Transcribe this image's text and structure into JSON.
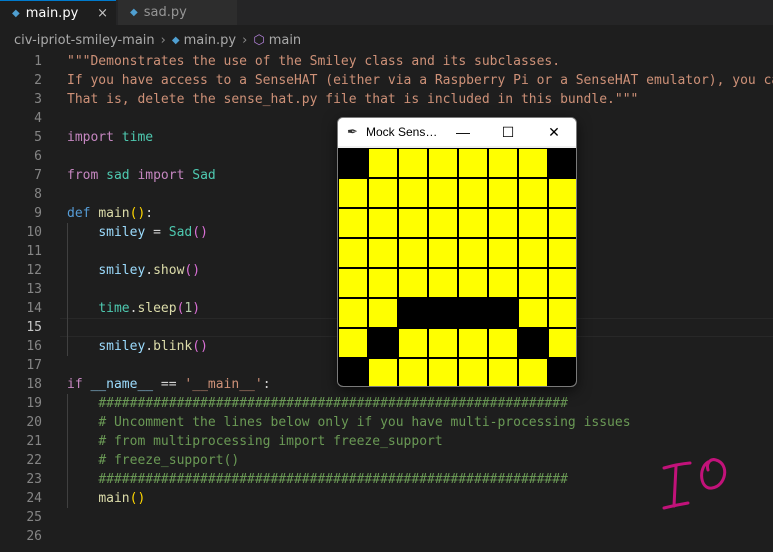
{
  "tabs": [
    {
      "label": "main.py",
      "close": "×"
    },
    {
      "label": "sad.py",
      "close": "×"
    }
  ],
  "breadcrumb": {
    "folder": "civ-ipriot-smiley-main",
    "file": "main.py",
    "symbol": "main"
  },
  "editor": {
    "current_line": 15,
    "lines": [
      {
        "no": "1",
        "tokens": [
          {
            "t": "\"\"\"Demonstrates the use of the Smiley class and its subclasses.",
            "c": "s"
          }
        ]
      },
      {
        "no": "2",
        "tokens": [
          {
            "t": "If you have access to a SenseHAT (either via a Raspberry Pi or a SenseHAT emulator), you can",
            "c": "s"
          }
        ]
      },
      {
        "no": "3",
        "tokens": [
          {
            "t": "That is, delete the sense_hat.py file that is included in this bundle.\"\"\"",
            "c": "s"
          }
        ]
      },
      {
        "no": "4",
        "tokens": []
      },
      {
        "no": "5",
        "tokens": [
          {
            "t": "import",
            "c": "k"
          },
          {
            "t": " ",
            "c": "p"
          },
          {
            "t": "time",
            "c": "m"
          }
        ]
      },
      {
        "no": "6",
        "tokens": []
      },
      {
        "no": "7",
        "tokens": [
          {
            "t": "from",
            "c": "k"
          },
          {
            "t": " ",
            "c": "p"
          },
          {
            "t": "sad",
            "c": "m"
          },
          {
            "t": " ",
            "c": "p"
          },
          {
            "t": "import",
            "c": "k"
          },
          {
            "t": " ",
            "c": "p"
          },
          {
            "t": "Sad",
            "c": "m"
          }
        ]
      },
      {
        "no": "8",
        "tokens": []
      },
      {
        "no": "9",
        "tokens": [
          {
            "t": "def",
            "c": "d"
          },
          {
            "t": " ",
            "c": "p"
          },
          {
            "t": "main",
            "c": "f"
          },
          {
            "t": "()",
            "c": "b"
          },
          {
            "t": ":",
            "c": "p"
          }
        ]
      },
      {
        "no": "10",
        "tokens": [
          {
            "t": "    ",
            "c": "p"
          },
          {
            "t": "smiley",
            "c": "v"
          },
          {
            "t": " = ",
            "c": "p"
          },
          {
            "t": "Sad",
            "c": "m"
          },
          {
            "t": "()",
            "c": "b2"
          }
        ]
      },
      {
        "no": "11",
        "tokens": []
      },
      {
        "no": "12",
        "tokens": [
          {
            "t": "    ",
            "c": "p"
          },
          {
            "t": "smiley",
            "c": "v"
          },
          {
            "t": ".",
            "c": "p"
          },
          {
            "t": "show",
            "c": "f"
          },
          {
            "t": "()",
            "c": "b2"
          }
        ]
      },
      {
        "no": "13",
        "tokens": []
      },
      {
        "no": "14",
        "tokens": [
          {
            "t": "    ",
            "c": "p"
          },
          {
            "t": "time",
            "c": "m"
          },
          {
            "t": ".",
            "c": "p"
          },
          {
            "t": "sleep",
            "c": "f"
          },
          {
            "t": "(",
            "c": "b2"
          },
          {
            "t": "1",
            "c": "n"
          },
          {
            "t": ")",
            "c": "b2"
          }
        ]
      },
      {
        "no": "15",
        "tokens": []
      },
      {
        "no": "16",
        "tokens": [
          {
            "t": "    ",
            "c": "p"
          },
          {
            "t": "smiley",
            "c": "v"
          },
          {
            "t": ".",
            "c": "p"
          },
          {
            "t": "blink",
            "c": "f"
          },
          {
            "t": "()",
            "c": "b2"
          }
        ]
      },
      {
        "no": "17",
        "tokens": []
      },
      {
        "no": "18",
        "tokens": [
          {
            "t": "if",
            "c": "k"
          },
          {
            "t": " ",
            "c": "p"
          },
          {
            "t": "__name__",
            "c": "v"
          },
          {
            "t": " == ",
            "c": "p"
          },
          {
            "t": "'__main__'",
            "c": "s"
          },
          {
            "t": ":",
            "c": "p"
          }
        ]
      },
      {
        "no": "19",
        "tokens": [
          {
            "t": "    ",
            "c": "p"
          },
          {
            "t": "############################################################",
            "c": "c"
          }
        ]
      },
      {
        "no": "20",
        "tokens": [
          {
            "t": "    ",
            "c": "p"
          },
          {
            "t": "# Uncomment the lines below only if you have multi-processing issues",
            "c": "c"
          }
        ]
      },
      {
        "no": "21",
        "tokens": [
          {
            "t": "    ",
            "c": "p"
          },
          {
            "t": "# from multiprocessing import freeze_support",
            "c": "c"
          }
        ]
      },
      {
        "no": "22",
        "tokens": [
          {
            "t": "    ",
            "c": "p"
          },
          {
            "t": "# freeze_support()",
            "c": "c"
          }
        ]
      },
      {
        "no": "23",
        "tokens": [
          {
            "t": "    ",
            "c": "p"
          },
          {
            "t": "############################################################",
            "c": "c"
          }
        ]
      },
      {
        "no": "24",
        "tokens": [
          {
            "t": "    ",
            "c": "p"
          },
          {
            "t": "main",
            "c": "f"
          },
          {
            "t": "()",
            "c": "b"
          }
        ]
      },
      {
        "no": "25",
        "tokens": []
      },
      {
        "no": "26",
        "tokens": []
      }
    ]
  },
  "mock_window": {
    "title": "Mock Sens…",
    "minimize": "—",
    "maximize": "☐",
    "close": "✕",
    "colors": {
      "Y": "#ffff00",
      "K": "#000000"
    },
    "pixels": [
      "KYYYYYYK",
      "YYYYYYYY",
      "YYYYYYYY",
      "YYYYYYYY",
      "YYYYYYYY",
      "YYKKKKYY",
      "YKYYYYKY",
      "KYYYYYYK"
    ]
  },
  "colors": {
    "editor_bg": "#1e1e1e",
    "tab_accent": "#007acc",
    "signature": "#c2127a"
  }
}
